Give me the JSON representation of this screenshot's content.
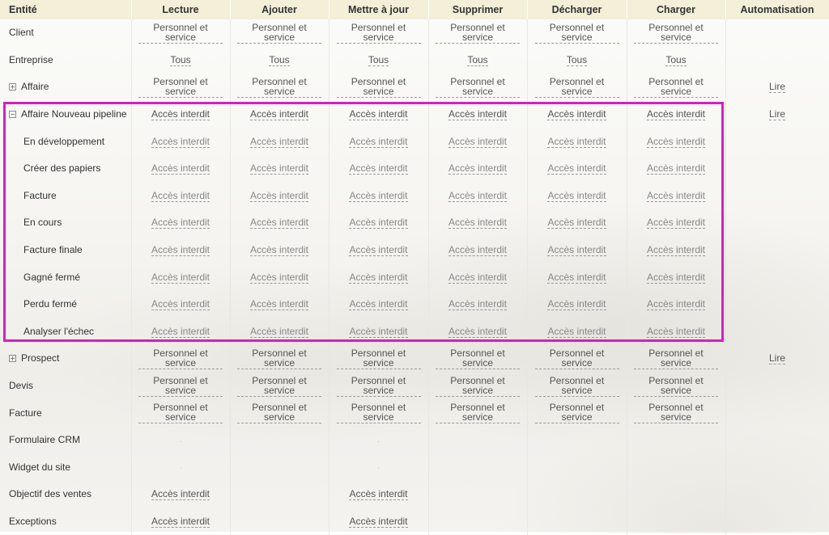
{
  "columns": [
    "Entité",
    "Lecture",
    "Ajouter",
    "Mettre à jour",
    "Supprimer",
    "Décharger",
    "Charger",
    "Automatisation"
  ],
  "perm_values": {
    "personnel": "Personnel et service",
    "tous": "Tous",
    "denied": "Accès interdit",
    "lire": "Lire",
    "dot": "·"
  },
  "rows": [
    {
      "entity": "Client"
    },
    {
      "entity": "Entreprise"
    },
    {
      "entity": "Affaire",
      "expander": "+",
      "automation": "Lire"
    },
    {
      "entity": "Affaire Nouveau pipeline",
      "expander": "−",
      "automation": "Lire"
    },
    {
      "entity": "En développement"
    },
    {
      "entity": "Créer des papiers"
    },
    {
      "entity": "Facture"
    },
    {
      "entity": "En cours"
    },
    {
      "entity": "Facture finale"
    },
    {
      "entity": "Gagné fermé"
    },
    {
      "entity": "Perdu fermé"
    },
    {
      "entity": "Analyser l'échec"
    },
    {
      "entity": "Prospect",
      "expander": "+",
      "automation": "Lire"
    },
    {
      "entity": "Devis"
    },
    {
      "entity": "Facture"
    },
    {
      "entity": "Formulaire CRM"
    },
    {
      "entity": "Widget du site"
    },
    {
      "entity": "Objectif des ventes"
    },
    {
      "entity": "Exceptions"
    }
  ],
  "highlight_color": "#d61fc1",
  "header_bg": "#f3efd8"
}
